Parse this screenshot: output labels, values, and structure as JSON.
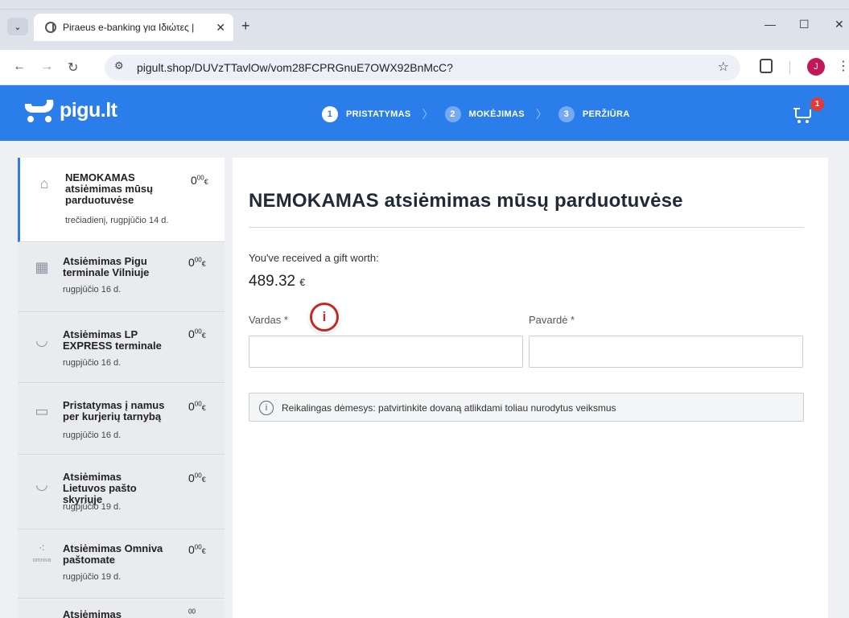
{
  "browser": {
    "tab_title": "Piraeus e-banking για Ιδιώτες |",
    "tab_close": "✕",
    "new_tab": "+",
    "url": "pigult.shop/DUVzTTavlOw/vom28FCPRGnuE7OWX92BnMcC?",
    "profile_initial": "J",
    "win_min": "—",
    "win_max": "☐",
    "win_close": "✕"
  },
  "header": {
    "logo_text": "pigu.lt",
    "cart_count": "1",
    "steps": [
      {
        "num": "1",
        "label": "PRISTATYMAS"
      },
      {
        "num": "2",
        "label": "MOKĖJIMAS"
      },
      {
        "num": "3",
        "label": "PERŽIŪRA"
      }
    ]
  },
  "delivery_options": [
    {
      "title": "NEMOKAMAS atsiėmimas mūsų parduotuvėse",
      "date": "trečiadienį, rugpjūčio 14 d.",
      "price_int": "0",
      "price_dec": "00",
      "currency": "€",
      "icon": "store-icon"
    },
    {
      "title": "Atsiėmimas Pigu terminale Vilniuje",
      "date": "rugpjūčio 16 d.",
      "price_int": "0",
      "price_dec": "00",
      "currency": "€",
      "icon": "locker-icon"
    },
    {
      "title": "Atsiėmimas LP EXPRESS terminale",
      "date": "rugpjūčio 16 d.",
      "price_int": "0",
      "price_dec": "00",
      "currency": "€",
      "icon": "horn-icon"
    },
    {
      "title": "Pristatymas į namus per kurjerių tarnybą",
      "date": "rugpjūčio 16 d.",
      "price_int": "0",
      "price_dec": "00",
      "currency": "€",
      "icon": "truck-icon"
    },
    {
      "title": "Atsiėmimas Lietuvos pašto skyriuje",
      "date": "rugpjūčio 19 d.",
      "price_int": "0",
      "price_dec": "00",
      "currency": "€",
      "icon": "post-horn-icon"
    },
    {
      "title": "Atsiėmimas Omniva paštomate",
      "date": "rugpjūčio 19 d.",
      "price_int": "0",
      "price_dec": "00",
      "currency": "€",
      "icon": "omniva-icon",
      "icon_caption": "omniva"
    },
    {
      "title": "Atsiėmimas",
      "date": "",
      "price_int": "",
      "price_dec": "00",
      "currency": "",
      "icon": ""
    }
  ],
  "main": {
    "title": "NEMOKAMAS atsiėmimas mūsų parduotuvėse",
    "gift_label": "You've received a gift worth:",
    "gift_value": "489.32",
    "gift_currency": "€",
    "first_name_label": "Vardas *",
    "last_name_label": "Pavardė *",
    "first_name_value": "",
    "last_name_value": "",
    "notice_text": "Reikalingas dėmesys: patvirtinkite dovaną atlikdami toliau nurodytus veiksmus"
  },
  "annotation": "i",
  "colors": {
    "brand_blue": "#2b7de9",
    "badge_red": "#e53935",
    "annotation_red": "#c62828"
  }
}
